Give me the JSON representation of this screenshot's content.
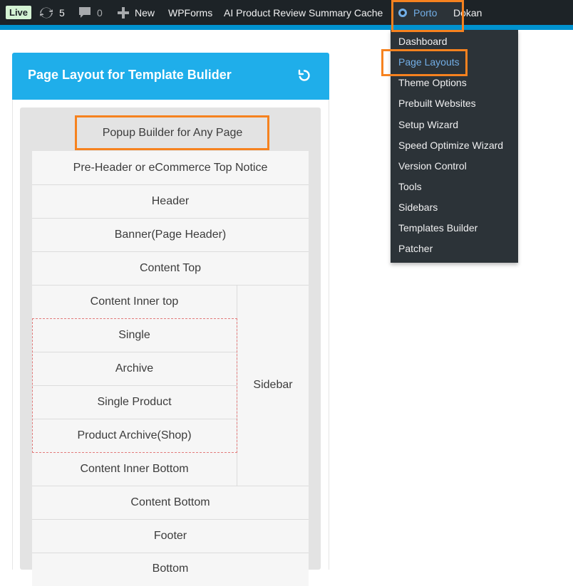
{
  "adminbar": {
    "live_label": "Live",
    "updates_count": "5",
    "comments_count": "0",
    "new_label": "New",
    "wpforms_label": "WPForms",
    "cache_label": "AI Product Review Summary Cache",
    "porto_label": "Porto",
    "dokan_label": "Dokan"
  },
  "porto_menu": {
    "items": [
      {
        "label": "Dashboard"
      },
      {
        "label": "Page Layouts"
      },
      {
        "label": "Theme Options"
      },
      {
        "label": "Prebuilt Websites"
      },
      {
        "label": "Setup Wizard"
      },
      {
        "label": "Speed Optimize Wizard"
      },
      {
        "label": "Version Control"
      },
      {
        "label": "Tools"
      },
      {
        "label": "Sidebars"
      },
      {
        "label": "Templates Builder"
      },
      {
        "label": "Patcher"
      }
    ],
    "active_item": "Page Layouts"
  },
  "panel": {
    "title": "Page Layout for Template Bulider",
    "layout": {
      "popup_builder": "Popup Builder for Any Page",
      "pre_header": "Pre-Header or eCommerce Top Notice",
      "header": "Header",
      "banner": "Banner(Page Header)",
      "content_top": "Content Top",
      "content_inner_top": "Content Inner top",
      "single": "Single",
      "archive": "Archive",
      "single_product": "Single Product",
      "product_archive": "Product Archive(Shop)",
      "content_inner_bottom": "Content Inner Bottom",
      "sidebar": "Sidebar",
      "content_bottom": "Content Bottom",
      "footer": "Footer",
      "bottom": "Bottom"
    }
  },
  "colors": {
    "adminbar_bg": "#1d2327",
    "accent_blue": "#1faeea",
    "highlight_orange": "#f6821f",
    "menu_active": "#72aee6"
  }
}
